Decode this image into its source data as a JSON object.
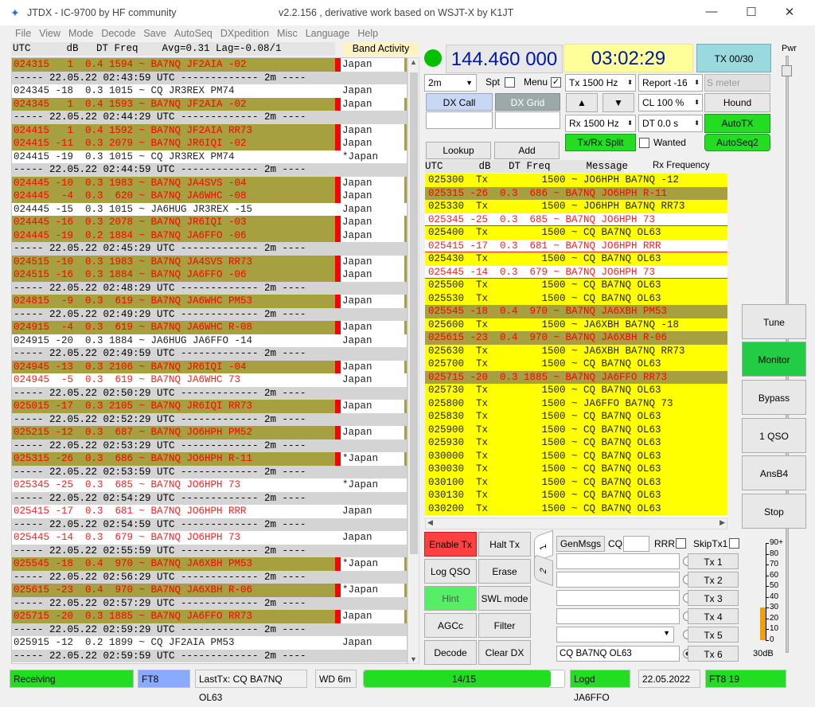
{
  "window": {
    "title": "JTDX - IC-9700  by HF community",
    "subtitle": "v2.2.156 , derivative work based on WSJT-X by K1JT"
  },
  "menu": [
    "File",
    "View",
    "Mode",
    "Decode",
    "Save",
    "AutoSeq",
    "DXpedition",
    "Misc",
    "Language",
    "Help"
  ],
  "band_activity": {
    "header": "UTC      dB   DT Freq    Avg=0.31 Lag=-0.08/1",
    "title": "Band Activity",
    "rows": [
      {
        "t": "024315   1  0.4 1594 ~ BA7NQ JF2AIA -02",
        "c": "Japan",
        "k": "hl"
      },
      {
        "t": "----- 22.05.22 02:43:59 UTC ------------- 2m ----",
        "c": "",
        "k": "sep"
      },
      {
        "t": "024345 -18  0.3 1015 ~ CQ JR3REX PM74",
        "c": "Japan",
        "k": "plain"
      },
      {
        "t": "024345   1  0.4 1593 ~ BA7NQ JF2AIA -02",
        "c": "Japan",
        "k": "hl"
      },
      {
        "t": "----- 22.05.22 02:44:29 UTC ------------- 2m ----",
        "c": "",
        "k": "sep"
      },
      {
        "t": "024415   1  0.4 1592 ~ BA7NQ JF2AIA RR73",
        "c": "Japan",
        "k": "hl"
      },
      {
        "t": "024415 -11  0.3 2079 ~ BA7NQ JR6IQI -02",
        "c": "Japan",
        "k": "hl"
      },
      {
        "t": "024415 -19  0.3 1015 ~ CQ JR3REX PM74",
        "c": "*Japan",
        "k": "plain"
      },
      {
        "t": "----- 22.05.22 02:44:59 UTC ------------- 2m ----",
        "c": "",
        "k": "sep"
      },
      {
        "t": "024445 -10  0.3 1983 ~ BA7NQ JA4SVS -04",
        "c": "Japan",
        "k": "hl"
      },
      {
        "t": "024445  -4  0.3  620 ~ BA7NQ JA6WHC -08",
        "c": "Japan",
        "k": "hl"
      },
      {
        "t": "024445 -15  0.3 1015 ~ JA6HUG JR3REX -15",
        "c": "Japan",
        "k": "plain"
      },
      {
        "t": "024445 -16  0.3 2078 ~ BA7NQ JR6IQI -03",
        "c": "Japan",
        "k": "hl"
      },
      {
        "t": "024445 -19  0.2 1884 ~ BA7NQ JA6FFO -06",
        "c": "Japan",
        "k": "hl"
      },
      {
        "t": "----- 22.05.22 02:45:29 UTC ------------- 2m ----",
        "c": "",
        "k": "sep"
      },
      {
        "t": "024515 -10  0.3 1983 ~ BA7NQ JA4SVS RR73",
        "c": "Japan",
        "k": "hl"
      },
      {
        "t": "024515 -16  0.3 1884 ~ BA7NQ JA6FFO -06",
        "c": "Japan",
        "k": "hl"
      },
      {
        "t": "----- 22.05.22 02:48:29 UTC ------------- 2m ----",
        "c": "",
        "k": "sep"
      },
      {
        "t": "024815  -9  0.3  619 ~ BA7NQ JA6WHC PM53",
        "c": "Japan",
        "k": "hl"
      },
      {
        "t": "----- 22.05.22 02:49:29 UTC ------------- 2m ----",
        "c": "",
        "k": "sep"
      },
      {
        "t": "024915  -4  0.3  619 ~ BA7NQ JA6WHC R-08",
        "c": "Japan",
        "k": "hl"
      },
      {
        "t": "024915 -20  0.3 1884 ~ JA6HUG JA6FFO -14",
        "c": "Japan",
        "k": "plain"
      },
      {
        "t": "----- 22.05.22 02:49:59 UTC ------------- 2m ----",
        "c": "",
        "k": "sep"
      },
      {
        "t": "024945 -13  0.3 2106 ~ BA7NQ JR6IQI -04",
        "c": "Japan",
        "k": "hl"
      },
      {
        "t": "024945  -5  0.3  619 ~ BA7NQ JA6WHC 73",
        "c": "Japan",
        "k": "red"
      },
      {
        "t": "----- 22.05.22 02:50:29 UTC ------------- 2m ----",
        "c": "",
        "k": "sep"
      },
      {
        "t": "025015 -17  0.3 2105 ~ BA7NQ JR6IQI RR73",
        "c": "Japan",
        "k": "hl"
      },
      {
        "t": "----- 22.05.22 02:52:29 UTC ------------- 2m ----",
        "c": "",
        "k": "sep"
      },
      {
        "t": "025215 -12  0.3  687 ~ BA7NQ JO6HPH PM52",
        "c": "Japan",
        "k": "hl"
      },
      {
        "t": "----- 22.05.22 02:53:29 UTC ------------- 2m ----",
        "c": "",
        "k": "sep"
      },
      {
        "t": "025315 -26  0.3  686 ~ BA7NQ JO6HPH R-11",
        "c": "*Japan",
        "k": "hl"
      },
      {
        "t": "----- 22.05.22 02:53:59 UTC ------------- 2m ----",
        "c": "",
        "k": "sep"
      },
      {
        "t": "025345 -25  0.3  685 ~ BA7NQ JO6HPH 73",
        "c": "*Japan",
        "k": "red"
      },
      {
        "t": "----- 22.05.22 02:54:29 UTC ------------- 2m ----",
        "c": "",
        "k": "sep"
      },
      {
        "t": "025415 -17  0.3  681 ~ BA7NQ JO6HPH RRR",
        "c": "Japan",
        "k": "red"
      },
      {
        "t": "----- 22.05.22 02:54:59 UTC ------------- 2m ----",
        "c": "",
        "k": "sep"
      },
      {
        "t": "025445 -14  0.3  679 ~ BA7NQ JO6HPH 73",
        "c": "Japan",
        "k": "red"
      },
      {
        "t": "----- 22.05.22 02:55:59 UTC ------------- 2m ----",
        "c": "",
        "k": "sep"
      },
      {
        "t": "025545 -18  0.4  970 ~ BA7NQ JA6XBH PM53",
        "c": "*Japan",
        "k": "hl"
      },
      {
        "t": "----- 22.05.22 02:56:29 UTC ------------- 2m ----",
        "c": "",
        "k": "sep"
      },
      {
        "t": "025615 -23  0.4  970 ~ BA7NQ JA6XBH R-06",
        "c": "*Japan",
        "k": "hl"
      },
      {
        "t": "----- 22.05.22 02:57:29 UTC ------------- 2m ----",
        "c": "",
        "k": "sep"
      },
      {
        "t": "025715 -20  0.3 1885 ~ BA7NQ JA6FFO RR73",
        "c": "Japan",
        "k": "hl"
      },
      {
        "t": "----- 22.05.22 02:59:29 UTC ------------- 2m ----",
        "c": "",
        "k": "sep"
      },
      {
        "t": "025915 -12  0.2 1899 ~ CQ JF2AIA PM53",
        "c": "Japan",
        "k": "plain"
      },
      {
        "t": "----- 22.05.22 02:59:59 UTC ------------- 2m ----",
        "c": "",
        "k": "sep"
      }
    ]
  },
  "controls": {
    "frequency": "144.460 000",
    "clock": "03:02:29",
    "tx_counter": "TX 00/30",
    "pwr_label": "Pwr",
    "band": "2m",
    "spt_label": "Spt",
    "menu_label": "Menu",
    "tx_freq": "Tx  1500  Hz",
    "report": "Report -16",
    "smeter": "S meter",
    "dx_call": "DX Call",
    "dx_grid": "DX Grid",
    "cl": "CL  100 %",
    "hound": "Hound",
    "rx_freq": "Rx  1500  Hz",
    "dt": "DT 0.0 s",
    "autotx": "AutoTX",
    "txrx_split": "Tx/Rx Split",
    "wanted": "Wanted",
    "autoseq2": "AutoSeq2",
    "lookup": "Lookup",
    "add": "Add",
    "up_arrow": "▲",
    "down_arrow": "▼"
  },
  "rx_frequency": {
    "header": "UTC      dB   DT Freq      Message",
    "title": "Rx Frequency",
    "rows": [
      {
        "t": "025300  Tx         1500 ~ JO6HPH BA7NQ -12",
        "k": "ry"
      },
      {
        "t": "025315 -26  0.3  686 ~ BA7NQ JO6HPH R-11",
        "k": "rh"
      },
      {
        "t": "025330  Tx         1500 ~ JO6HPH BA7NQ RR73",
        "k": "ry"
      },
      {
        "t": "025345 -25  0.3  685 ~ BA7NQ JO6HPH 73",
        "k": "rw"
      },
      {
        "t": "025400  Tx         1500 ~ CQ BA7NQ OL63",
        "k": "ry"
      },
      {
        "t": "025415 -17  0.3  681 ~ BA7NQ JO6HPH RRR",
        "k": "rw"
      },
      {
        "t": "025430  Tx         1500 ~ CQ BA7NQ OL63",
        "k": "ry"
      },
      {
        "t": "025445 -14  0.3  679 ~ BA7NQ JO6HPH 73",
        "k": "rw"
      },
      {
        "t": "025500  Tx         1500 ~ CQ BA7NQ OL63",
        "k": "ry"
      },
      {
        "t": "025530  Tx         1500 ~ CQ BA7NQ OL63",
        "k": "ry"
      },
      {
        "t": "025545 -18  0.4  970 ~ BA7NQ JA6XBH PM53",
        "k": "rh"
      },
      {
        "t": "025600  Tx         1500 ~ JA6XBH BA7NQ -18",
        "k": "ry"
      },
      {
        "t": "025615 -23  0.4  970 ~ BA7NQ JA6XBH R-06",
        "k": "rh"
      },
      {
        "t": "025630  Tx         1500 ~ JA6XBH BA7NQ RR73",
        "k": "ry"
      },
      {
        "t": "025700  Tx         1500 ~ CQ BA7NQ OL63",
        "k": "ry"
      },
      {
        "t": "025715 -20  0.3 1885 ~ BA7NQ JA6FFO RR73",
        "k": "rh"
      },
      {
        "t": "025730  Tx         1500 ~ CQ BA7NQ OL63",
        "k": "ry"
      },
      {
        "t": "025800  Tx         1500 ~ JA6FFO BA7NQ 73",
        "k": "ry"
      },
      {
        "t": "025830  Tx         1500 ~ CQ BA7NQ OL63",
        "k": "ry"
      },
      {
        "t": "025900  Tx         1500 ~ CQ BA7NQ OL63",
        "k": "ry"
      },
      {
        "t": "025930  Tx         1500 ~ CQ BA7NQ OL63",
        "k": "ry"
      },
      {
        "t": "030000  Tx         1500 ~ CQ BA7NQ OL63",
        "k": "ry"
      },
      {
        "t": "030030  Tx         1500 ~ CQ BA7NQ OL63",
        "k": "ry"
      },
      {
        "t": "030100  Tx         1500 ~ CQ BA7NQ OL63",
        "k": "ry"
      },
      {
        "t": "030130  Tx         1500 ~ CQ BA7NQ OL63",
        "k": "ry"
      },
      {
        "t": "030200  Tx         1500 ~ CQ BA7NQ OL63",
        "k": "ry"
      }
    ]
  },
  "side_buttons": {
    "tune": "Tune",
    "monitor": "Monitor",
    "bypass": "Bypass",
    "one_qso": "1 QSO",
    "ansb4": "AnsB4",
    "stop": "Stop"
  },
  "bottom_buttons": {
    "enable_tx": "Enable Tx",
    "halt_tx": "Halt Tx",
    "log_qso": "Log QSO",
    "erase": "Erase",
    "hint": "Hint",
    "swl": "SWL mode",
    "agcc": "AGCc",
    "filter": "Filter",
    "decode": "Decode",
    "clear_dx": "Clear DX"
  },
  "tx_panel": {
    "tab1": "1",
    "tab2": "2",
    "genmsgs": "GenMsgs",
    "cq": "CQ",
    "rrr": "RRR",
    "skiptx1": "SkipTx1",
    "tx_labels": [
      "Tx 1",
      "Tx 2",
      "Tx 3",
      "Tx 4",
      "Tx 5",
      "Tx 6"
    ],
    "tx6_value": "CQ BA7NQ OL63"
  },
  "meter": {
    "labels": [
      "90+",
      "80",
      "70",
      "60",
      "50",
      "40",
      "30",
      "20",
      "10",
      "0"
    ],
    "value": "30dB",
    "level_db": 30
  },
  "status": {
    "state": "Receiving",
    "mode": "FT8",
    "last_tx": "LastTx: CQ BA7NQ OL63",
    "wd": "WD 6m",
    "progress": "14/15",
    "progress_fraction": 0.933,
    "logged": "Logd JA6FFO",
    "date": "22.05.2022",
    "ft8_count": "FT8  19"
  },
  "colors": {
    "highlight": "#a6a040",
    "red_text": "#ff0000",
    "yellow": "#ffff00",
    "green": "#22dd22",
    "freq_blue": "#0017a6"
  }
}
